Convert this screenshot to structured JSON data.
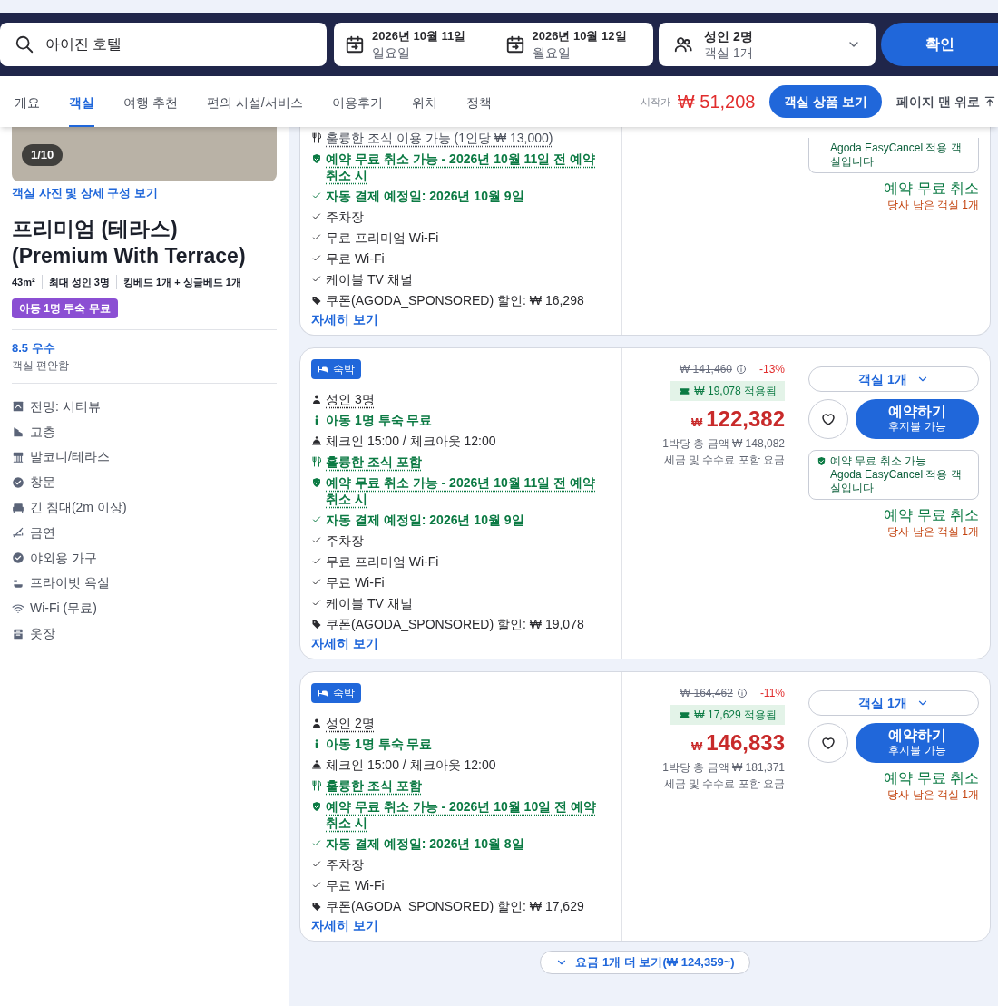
{
  "search": {
    "value": "아이진 호텔",
    "dates": [
      {
        "date": "2026년 10월 11일",
        "day": "일요일"
      },
      {
        "date": "2026년 10월 12일",
        "day": "월요일"
      }
    ],
    "guests": {
      "main": "성인 2명",
      "sub": "객실 1개"
    },
    "confirm": "확인"
  },
  "nav": {
    "tabs": [
      {
        "label": "개요",
        "selected": false
      },
      {
        "label": "객실",
        "selected": true
      },
      {
        "label": "여행 추천",
        "selected": false
      },
      {
        "label": "편의 시설/서비스",
        "selected": false
      },
      {
        "label": "이용후기",
        "selected": false
      },
      {
        "label": "위치",
        "selected": false
      },
      {
        "label": "정책",
        "selected": false
      }
    ],
    "from_label": "시작가",
    "from_price": "₩ 51,208",
    "rooms_button": "객실 상품 보기",
    "top_link": "페이지 맨 위로"
  },
  "room": {
    "photo_counter": "1/10",
    "photo_link": "객실 사진 및 상세 구성 보기",
    "title": "프리미엄 (테라스) (Premium With Terrace)",
    "specs": [
      "43m²",
      "최대 성인 3명",
      "킹베드 1개 + 싱글베드 1개"
    ],
    "badge": "아동 1명 투숙 무료",
    "rating": "8.5 우수",
    "rating_note": "객실 편안함",
    "amenities": [
      {
        "kind": "view",
        "text": "전망: 시티뷰"
      },
      {
        "kind": "floor",
        "text": "고층"
      },
      {
        "kind": "balcony",
        "text": "발코니/테라스"
      },
      {
        "kind": "check",
        "text": "창문"
      },
      {
        "kind": "bed",
        "text": "긴 침대(2m 이상)"
      },
      {
        "kind": "nosmoking",
        "text": "금연"
      },
      {
        "kind": "check",
        "text": "야외용 가구"
      },
      {
        "kind": "bath",
        "text": "프라이빗 욕실"
      },
      {
        "kind": "wifi",
        "text": "Wi-Fi (무료)"
      },
      {
        "kind": "closet",
        "text": "옷장"
      }
    ]
  },
  "offers": [
    {
      "features": [
        {
          "kind": "breakfast-paid",
          "text": "훌륭한 조식 이용 가능 (1인당 ₩ 13,000)"
        },
        {
          "kind": "cancel",
          "text": "예약 무료 취소 가능 - 2026년 10월 11일 전 예약 취소 시"
        },
        {
          "kind": "payment",
          "text": "자동 결제 예정일: 2026년 10월 9일"
        },
        {
          "kind": "amenity",
          "text": "주차장"
        },
        {
          "kind": "amenity",
          "text": "무료 프리미엄 Wi-Fi"
        },
        {
          "kind": "amenity",
          "text": "무료 Wi-Fi"
        },
        {
          "kind": "amenity",
          "text": "케이블 TV 채널"
        },
        {
          "kind": "coupon",
          "text": "쿠폰(AGODA_SPONSORED) 할인: ₩ 16,298"
        }
      ],
      "details_link": "자세히 보기",
      "actions": {
        "cancel_box": {
          "body": "Agoda EasyCancel 적용 객실입니다"
        },
        "cancel_text": "예약 무료 취소",
        "rooms_left": "당사 남은 객실 1개"
      }
    },
    {
      "tag": "숙박",
      "features": [
        {
          "kind": "guests",
          "text": "성인 3명"
        },
        {
          "kind": "child",
          "text": "아동 1명 투숙 무료"
        },
        {
          "kind": "checkin",
          "text": "체크인 15:00 / 체크아웃 12:00"
        },
        {
          "kind": "breakfast",
          "text": "훌륭한 조식 포함"
        },
        {
          "kind": "cancel",
          "text": "예약 무료 취소 가능 - 2026년 10월 11일 전 예약 취소 시"
        },
        {
          "kind": "payment",
          "text": "자동 결제 예정일: 2026년 10월 9일"
        },
        {
          "kind": "amenity",
          "text": "주차장"
        },
        {
          "kind": "amenity",
          "text": "무료 프리미엄 Wi-Fi"
        },
        {
          "kind": "amenity",
          "text": "무료 Wi-Fi"
        },
        {
          "kind": "amenity",
          "text": "케이블 TV 채널"
        },
        {
          "kind": "coupon",
          "text": "쿠폰(AGODA_SPONSORED) 할인: ₩ 19,078"
        }
      ],
      "details_link": "자세히 보기",
      "price": {
        "original": "₩ 141,460",
        "discount": "-13%",
        "coupon_applied": "₩ 19,078 적용됨",
        "currency": "₩",
        "amount": "122,382",
        "total": "1박당 총 금액 ₩ 148,082",
        "tax_note": "세금 및 수수료 포함 요금"
      },
      "actions": {
        "rooms": "객실 1개",
        "book": "예약하기",
        "book_sub": "후지불 가능",
        "cancel_box": {
          "title": "예약 무료 취소 가능",
          "body": "Agoda EasyCancel 적용 객실입니다"
        },
        "cancel_text": "예약 무료 취소",
        "rooms_left": "당사 남은 객실 1개"
      }
    },
    {
      "tag": "숙박",
      "features": [
        {
          "kind": "guests",
          "text": "성인 2명"
        },
        {
          "kind": "child",
          "text": "아동 1명 투숙 무료"
        },
        {
          "kind": "checkin",
          "text": "체크인 15:00 / 체크아웃 12:00"
        },
        {
          "kind": "breakfast",
          "text": "훌륭한 조식 포함"
        },
        {
          "kind": "cancel",
          "text": "예약 무료 취소 가능 - 2026년 10월 10일 전 예약 취소 시"
        },
        {
          "kind": "payment",
          "text": "자동 결제 예정일: 2026년 10월 8일"
        },
        {
          "kind": "amenity",
          "text": "주차장"
        },
        {
          "kind": "amenity",
          "text": "무료 Wi-Fi"
        },
        {
          "kind": "coupon",
          "text": "쿠폰(AGODA_SPONSORED) 할인: ₩ 17,629"
        }
      ],
      "details_link": "자세히 보기",
      "price": {
        "original": "₩ 164,462",
        "discount": "-11%",
        "coupon_applied": "₩ 17,629 적용됨",
        "currency": "₩",
        "amount": "146,833",
        "total": "1박당 총 금액 ₩ 181,371",
        "tax_note": "세금 및 수수료 포함 요금"
      },
      "actions": {
        "rooms": "객실 1개",
        "book": "예약하기",
        "book_sub": "후지불 가능",
        "cancel_text": "예약 무료 취소",
        "rooms_left": "당사 남은 객실 1개"
      }
    }
  ],
  "more_rates": "요금 1개 더 보기(₩ 124,359~)"
}
